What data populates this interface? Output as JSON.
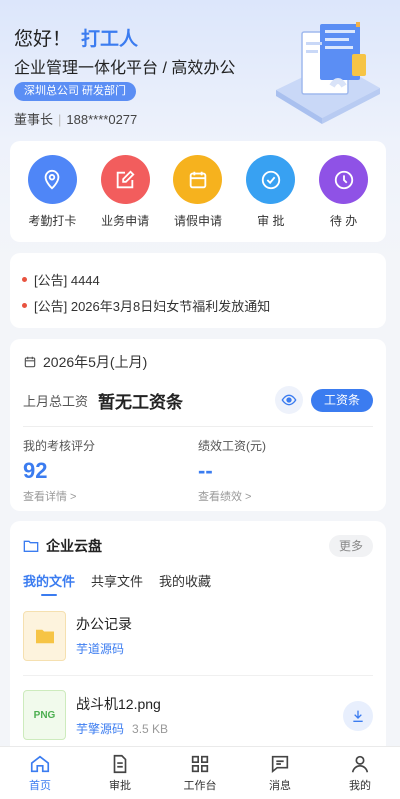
{
  "header": {
    "greeting": "您好！",
    "user_name": "打工人",
    "slogan": "企业管理一体化平台 / 高效办公",
    "dept_badge": "深圳总公司  研发部门",
    "role": "董事长",
    "phone": "188****0277"
  },
  "quick_actions": [
    {
      "label": "考勤打卡",
      "icon": "location-pin-icon",
      "color": "#4f86f7"
    },
    {
      "label": "业务申请",
      "icon": "edit-icon",
      "color": "#f25d5d"
    },
    {
      "label": "请假申请",
      "icon": "calendar-icon",
      "color": "#f6b21e"
    },
    {
      "label": "审 批",
      "icon": "check-circle-icon",
      "color": "#38a1f2"
    },
    {
      "label": "待 办",
      "icon": "clock-icon",
      "color": "#8f52e6"
    }
  ],
  "notices": [
    {
      "text": "[公告] 4444"
    },
    {
      "text": "[公告] 2026年3月8日妇女节福利发放通知"
    }
  ],
  "salary": {
    "period": "2026年5月(上月)",
    "last_month_label": "上月总工资",
    "last_month_value": "暂无工资条",
    "slip_button": "工资条",
    "score_label": "我的考核评分",
    "score_value": "92",
    "score_link": "查看详情 >",
    "perf_label": "绩效工资(元)",
    "perf_value": "--",
    "perf_link": "查看绩效 >"
  },
  "cloud": {
    "title": "企业云盘",
    "more": "更多",
    "tabs": [
      "我的文件",
      "共享文件",
      "我的收藏"
    ],
    "files": [
      {
        "name": "办公记录",
        "owner": "芋道源码",
        "size": "",
        "thumb": "folder-icon"
      },
      {
        "name": "战斗机12.png",
        "owner": "芋擎源码",
        "size": "3.5 KB",
        "thumb": "PNG"
      }
    ]
  },
  "tabbar": {
    "items": [
      {
        "label": "首页",
        "icon": "home-icon"
      },
      {
        "label": "审批",
        "icon": "document-icon"
      },
      {
        "label": "工作台",
        "icon": "grid-icon"
      },
      {
        "label": "消息",
        "icon": "message-icon"
      },
      {
        "label": "我的",
        "icon": "user-icon"
      }
    ]
  },
  "colors": {
    "primary": "#3b7cf0",
    "notice_dot": "#e8533f"
  }
}
